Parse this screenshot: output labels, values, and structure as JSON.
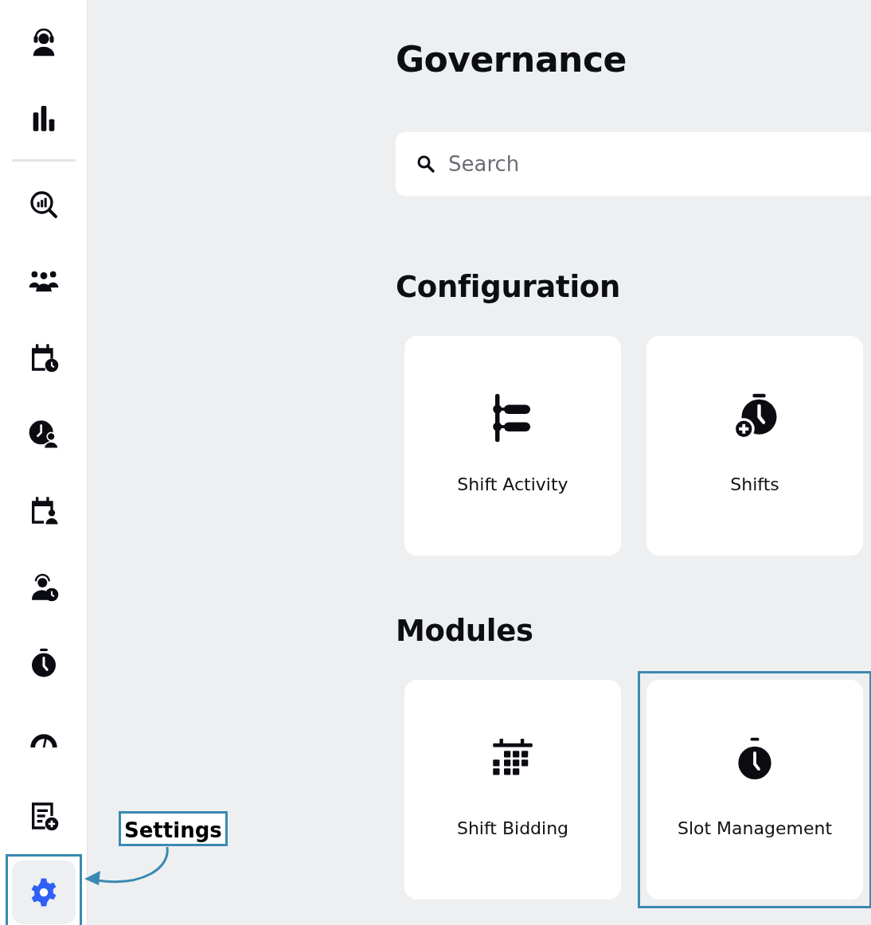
{
  "sidebar": {
    "top_items": [
      {
        "selected": false,
        "highlighted": false
      },
      {
        "selected": false,
        "highlighted": false
      }
    ],
    "items": [
      {
        "selected": false,
        "highlighted": false
      },
      {
        "selected": false,
        "highlighted": false
      },
      {
        "selected": false,
        "highlighted": false
      },
      {
        "selected": false,
        "highlighted": false
      },
      {
        "selected": false,
        "highlighted": false
      },
      {
        "selected": false,
        "highlighted": false
      },
      {
        "selected": false,
        "highlighted": false
      },
      {
        "selected": false,
        "highlighted": false
      },
      {
        "selected": false,
        "highlighted": false
      },
      {
        "selected": true,
        "highlighted": true
      }
    ]
  },
  "page": {
    "title": "Governance",
    "search": {
      "placeholder": "Search"
    },
    "sections": [
      {
        "heading": "Configuration",
        "cards": [
          {
            "label": "Shift Activity",
            "highlighted": false
          },
          {
            "label": "Shifts",
            "highlighted": false
          }
        ]
      },
      {
        "heading": "Modules",
        "cards": [
          {
            "label": "Shift Bidding",
            "highlighted": false
          },
          {
            "label": "Slot Management",
            "highlighted": true
          }
        ]
      }
    ]
  },
  "annotation": {
    "callout": "Settings"
  }
}
